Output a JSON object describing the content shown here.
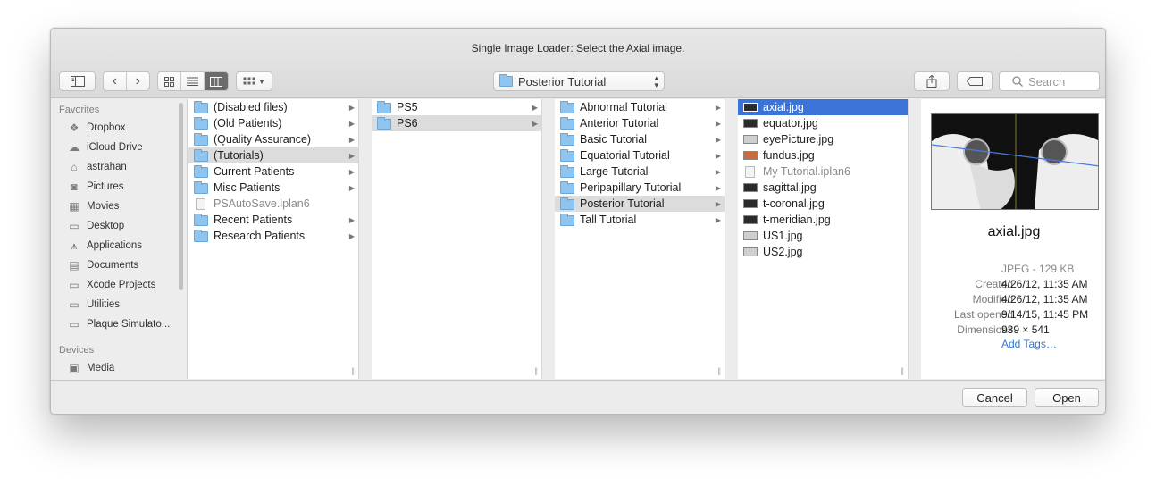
{
  "dialog": {
    "title": "Single Image Loader: Select the Axial image."
  },
  "toolbar": {
    "path_popup": "Posterior Tutorial",
    "search_placeholder": "Search"
  },
  "sidebar": {
    "favorites_header": "Favorites",
    "favorites": [
      {
        "label": "Dropbox",
        "icon": "dropbox-icon"
      },
      {
        "label": "iCloud Drive",
        "icon": "cloud-icon"
      },
      {
        "label": "astrahan",
        "icon": "home-icon"
      },
      {
        "label": "Pictures",
        "icon": "camera-icon"
      },
      {
        "label": "Movies",
        "icon": "film-icon"
      },
      {
        "label": "Desktop",
        "icon": "desktop-icon"
      },
      {
        "label": "Applications",
        "icon": "applications-icon"
      },
      {
        "label": "Documents",
        "icon": "document-icon"
      },
      {
        "label": "Xcode Projects",
        "icon": "folder-icon"
      },
      {
        "label": "Utilities",
        "icon": "folder-icon"
      },
      {
        "label": "Plaque Simulato...",
        "icon": "folder-icon"
      }
    ],
    "devices_header": "Devices",
    "devices": [
      {
        "label": "Media",
        "icon": "disk-icon"
      }
    ]
  },
  "columns": {
    "col1": [
      {
        "label": "(Disabled files)",
        "kind": "folder",
        "arrow": true
      },
      {
        "label": "(Old Patients)",
        "kind": "folder",
        "arrow": true
      },
      {
        "label": "(Quality Assurance)",
        "kind": "folder",
        "arrow": true
      },
      {
        "label": "(Tutorials)",
        "kind": "folder",
        "arrow": true,
        "selected": "grey"
      },
      {
        "label": "Current Patients",
        "kind": "folder",
        "arrow": true
      },
      {
        "label": "Misc Patients",
        "kind": "folder",
        "arrow": true
      },
      {
        "label": "PSAutoSave.iplan6",
        "kind": "doc",
        "arrow": false,
        "dim": true
      },
      {
        "label": "Recent Patients",
        "kind": "folder",
        "arrow": true
      },
      {
        "label": "Research Patients",
        "kind": "folder",
        "arrow": true
      }
    ],
    "col2": [
      {
        "label": "PS5",
        "kind": "folder",
        "arrow": true
      },
      {
        "label": "PS6",
        "kind": "folder",
        "arrow": true,
        "selected": "grey"
      }
    ],
    "col3": [
      {
        "label": "Abnormal Tutorial",
        "kind": "folder",
        "arrow": true
      },
      {
        "label": "Anterior Tutorial",
        "kind": "folder",
        "arrow": true
      },
      {
        "label": "Basic Tutorial",
        "kind": "folder",
        "arrow": true
      },
      {
        "label": "Equatorial Tutorial",
        "kind": "folder",
        "arrow": true
      },
      {
        "label": "Large Tutorial",
        "kind": "folder",
        "arrow": true
      },
      {
        "label": "Peripapillary Tutorial",
        "kind": "folder",
        "arrow": true
      },
      {
        "label": "Posterior Tutorial",
        "kind": "folder",
        "arrow": true,
        "selected": "grey"
      },
      {
        "label": "Tall Tutorial",
        "kind": "folder",
        "arrow": true
      }
    ],
    "col4": [
      {
        "label": "axial.jpg",
        "kind": "img",
        "selected": "blue"
      },
      {
        "label": "equator.jpg",
        "kind": "img"
      },
      {
        "label": "eyePicture.jpg",
        "kind": "img-light"
      },
      {
        "label": "fundus.jpg",
        "kind": "img-orange"
      },
      {
        "label": "My Tutorial.iplan6",
        "kind": "doc",
        "dim": true
      },
      {
        "label": "sagittal.jpg",
        "kind": "img"
      },
      {
        "label": "t-coronal.jpg",
        "kind": "img"
      },
      {
        "label": "t-meridian.jpg",
        "kind": "img"
      },
      {
        "label": "US1.jpg",
        "kind": "img-light"
      },
      {
        "label": "US2.jpg",
        "kind": "img-light"
      }
    ]
  },
  "preview": {
    "name": "axial.jpg",
    "kind_size": "JPEG - 129 KB",
    "meta": [
      {
        "label": "Created",
        "value": "4/26/12, 11:35 AM"
      },
      {
        "label": "Modified",
        "value": "4/26/12, 11:35 AM"
      },
      {
        "label": "Last opened",
        "value": "9/14/15, 11:45 PM"
      },
      {
        "label": "Dimensions",
        "value": "939 × 541"
      }
    ],
    "add_tags": "Add Tags…"
  },
  "buttons": {
    "cancel": "Cancel",
    "open": "Open"
  }
}
